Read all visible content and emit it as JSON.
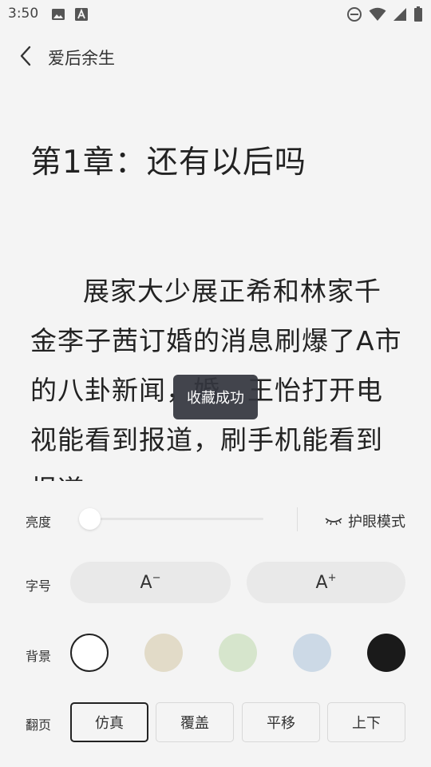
{
  "status_bar": {
    "time": "3:50",
    "left_icons": [
      "image-icon",
      "text-a-icon"
    ],
    "right_icons": [
      "do-not-disturb-icon",
      "wifi-icon",
      "signal-icon",
      "battery-icon"
    ]
  },
  "header": {
    "book_title": "爱后余生"
  },
  "reader": {
    "chapter_title": "第1章：还有以后吗",
    "body_text": "展家大少展正希和林家千金李子茜订婚的消息刷爆了A市的八卦新闻，婚。王怡打开电视能看到报道，刷手机能看到报道"
  },
  "toast": {
    "message": "收藏成功"
  },
  "settings": {
    "brightness_label": "亮度",
    "brightness_level": 0.0,
    "eye_mode_label": "护眼模式",
    "font_label": "字号",
    "font_decrease": "A",
    "font_decrease_sup": "−",
    "font_increase": "A",
    "font_increase_sup": "+",
    "background_label": "背景",
    "backgrounds": [
      {
        "name": "white",
        "color": "#ffffff",
        "selected": true
      },
      {
        "name": "beige",
        "color": "#e2dbc8",
        "selected": false
      },
      {
        "name": "green",
        "color": "#d6e5cc",
        "selected": false
      },
      {
        "name": "blue",
        "color": "#ccd9e6",
        "selected": false
      },
      {
        "name": "black",
        "color": "#1a1a1a",
        "selected": false
      }
    ],
    "page_turn_label": "翻页",
    "page_turn_options": [
      "仿真",
      "覆盖",
      "平移",
      "上下"
    ],
    "page_turn_selected": "仿真"
  }
}
